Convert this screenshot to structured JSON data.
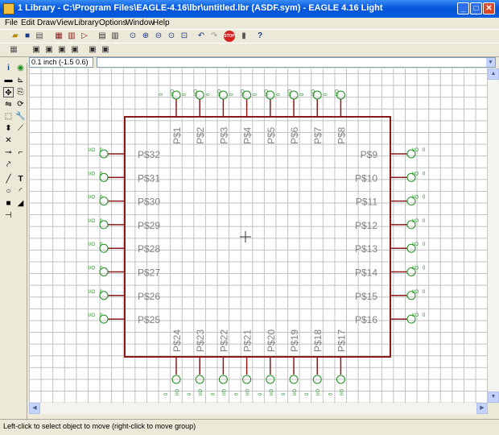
{
  "window": {
    "title": "1 Library - C:\\Program Files\\EAGLE-4.16\\lbr\\untitled.lbr (ASDF.sym) - EAGLE 4.16 Light",
    "buttons": [
      "_",
      "□",
      "✕"
    ]
  },
  "menu": [
    "File",
    "Edit",
    "Draw",
    "View",
    "Library",
    "Options",
    "Window",
    "Help"
  ],
  "toolbar1": {
    "icons": [
      "open-icon",
      "save-icon",
      "print-icon",
      "cam-icon",
      "board-icon",
      "schematic-icon",
      "symbol-icon",
      "script-icon",
      "run-ulp-icon",
      "zoom-fit-icon",
      "zoom-in-icon",
      "zoom-out-icon",
      "zoom-redraw-icon",
      "zoom-select-icon",
      "undo-icon",
      "redo-icon",
      "stop-icon",
      "go-icon",
      "help-icon"
    ],
    "stop_label": "STOP",
    "help_label": "?"
  },
  "coordinates": "0.1 inch (-1.5 0.6)",
  "command_value": "",
  "status": "Left-click to select object to move (right-click to move group)",
  "symbol": {
    "top_pins": [
      "P$1",
      "P$2",
      "P$3",
      "P$4",
      "P$5",
      "P$6",
      "P$7",
      "P$8"
    ],
    "right_pins": [
      "P$9",
      "P$10",
      "P$11",
      "P$12",
      "P$13",
      "P$14",
      "P$15",
      "P$16"
    ],
    "bottom_pins": [
      "P$24",
      "P$23",
      "P$22",
      "P$21",
      "P$20",
      "P$19",
      "P$18",
      "P$17"
    ],
    "left_pins": [
      "P$32",
      "P$31",
      "P$30",
      "P$29",
      "P$28",
      "P$27",
      "P$26",
      "P$25"
    ],
    "pin_direction_label": "I/O",
    "pin_swap_label": "0",
    "colors": {
      "outline": "#8b1a1a",
      "pin_text": "#1e8c1e",
      "pin_line": "#8b1a1a",
      "grid": "#c0c0c0",
      "name_text": "#808080"
    }
  }
}
